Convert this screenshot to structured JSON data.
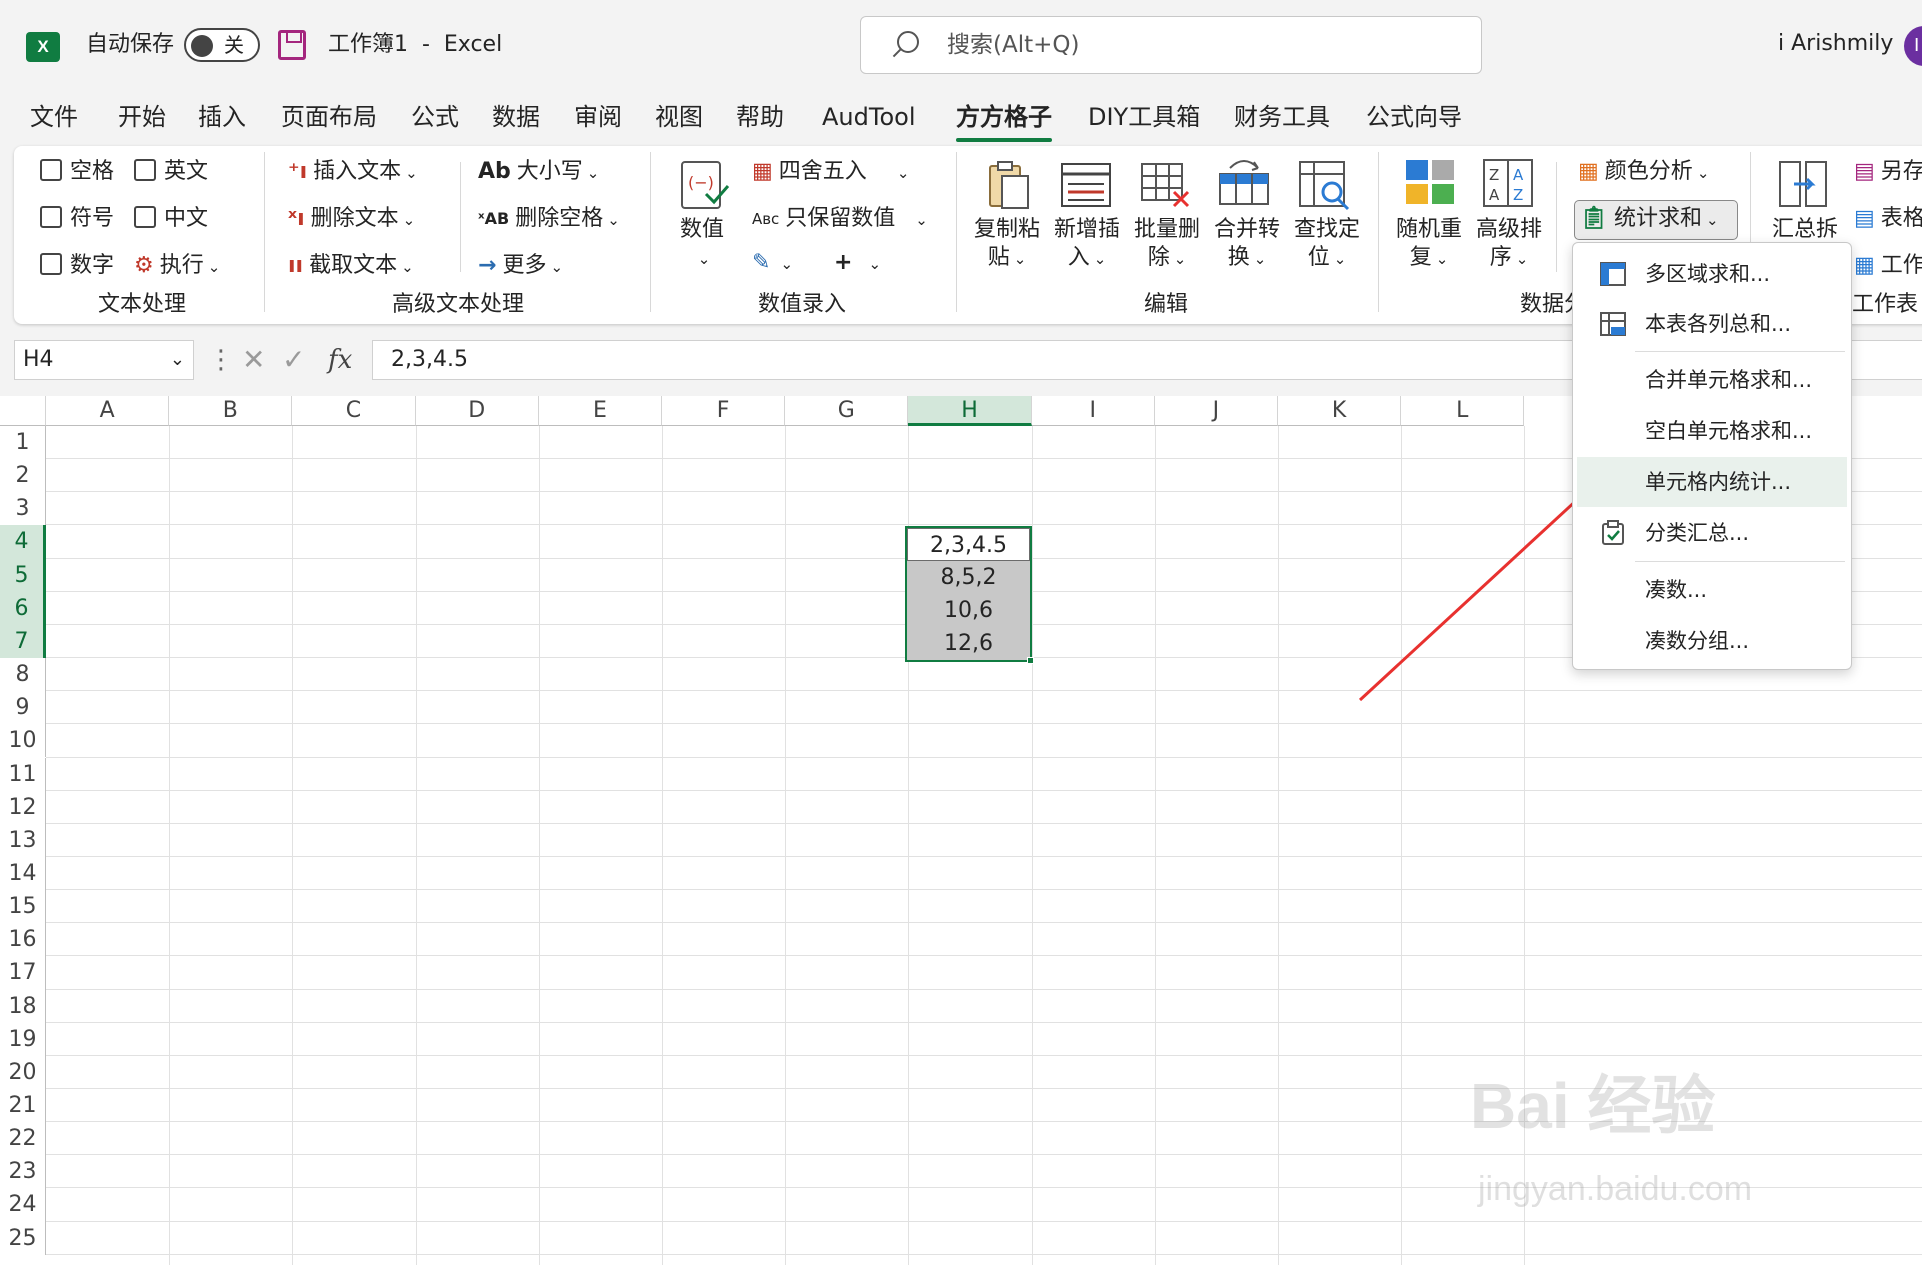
{
  "titlebar": {
    "autosave_label": "自动保存",
    "autosave_state": "关",
    "workbook_title": "工作簿1  -  Excel",
    "search_placeholder": "搜索(Alt+Q)",
    "user_name": "i Arishmily",
    "avatar_initial": "I",
    "app_icon_letter": "X"
  },
  "tabs": [
    "文件",
    "开始",
    "插入",
    "页面布局",
    "公式",
    "数据",
    "审阅",
    "视图",
    "帮助",
    "AudTool",
    "方方格子",
    "DIY工具箱",
    "财务工具",
    "公式向导"
  ],
  "active_tab": "方方格子",
  "ribbon": {
    "text_group": {
      "checkboxes": [
        "空格",
        "英文",
        "符号",
        "中文",
        "数字"
      ],
      "execute": "执行",
      "label": "文本处理"
    },
    "adv_text_group": {
      "insert_text": "插入文本",
      "delete_text": "删除文本",
      "extract_text": "截取文本",
      "case": "大小写",
      "delete_spaces": "删除空格",
      "more": "更多",
      "label": "高级文本处理"
    },
    "number_group": {
      "value": "数值",
      "round": "四舍五入",
      "keep_values": "只保留数值",
      "label": "数值录入"
    },
    "edit_group": {
      "copy_paste": [
        "复制粘",
        "贴"
      ],
      "new_insert": [
        "新增插",
        "入"
      ],
      "batch_delete": [
        "批量删",
        "除"
      ],
      "merge_convert": [
        "合并转",
        "换"
      ],
      "find_locate": [
        "查找定",
        "位"
      ],
      "label": "编辑"
    },
    "data_group": {
      "random_repeat": [
        "随机重",
        "复"
      ],
      "advanced_sort": [
        "高级排",
        "序"
      ],
      "color_analysis": "颜色分析",
      "stats_sum": "统计求和",
      "label": "数据分"
    },
    "right_group": {
      "summary_split": "汇总拆",
      "save_as": "另存",
      "table": "表格",
      "workbook": "工作",
      "label": "工作表"
    }
  },
  "formula_bar": {
    "name_box": "H4",
    "formula": "2,3,4.5"
  },
  "grid": {
    "columns": [
      "A",
      "B",
      "C",
      "D",
      "E",
      "F",
      "G",
      "H",
      "I",
      "J",
      "K",
      "L"
    ],
    "rows": [
      "1",
      "2",
      "3",
      "4",
      "5",
      "6",
      "7",
      "8",
      "9",
      "10",
      "11",
      "12",
      "13",
      "14",
      "15",
      "16",
      "17",
      "18",
      "19",
      "20",
      "21",
      "22",
      "23",
      "24",
      "25"
    ],
    "selected_column": "H",
    "selected_rows": [
      "4",
      "5",
      "6",
      "7"
    ],
    "cells": [
      {
        "ref": "H4",
        "value": "2,3,4.5"
      },
      {
        "ref": "H5",
        "value": "8,5,2"
      },
      {
        "ref": "H6",
        "value": "10,6"
      },
      {
        "ref": "H7",
        "value": "12,6"
      }
    ]
  },
  "dropdown_menu": {
    "items": [
      "多区域求和...",
      "本表各列总和...",
      "合并单元格求和...",
      "空白单元格求和...",
      "单元格内统计...",
      "分类汇总...",
      "凑数...",
      "凑数分组..."
    ],
    "highlighted": "单元格内统计..."
  },
  "watermark": {
    "brand": "Bai 经验",
    "url": "jingyan.baidu.com"
  },
  "colors": {
    "excel_green": "#107c41",
    "arrow_red": "#e8312f",
    "save_icon": "#a4267e"
  }
}
